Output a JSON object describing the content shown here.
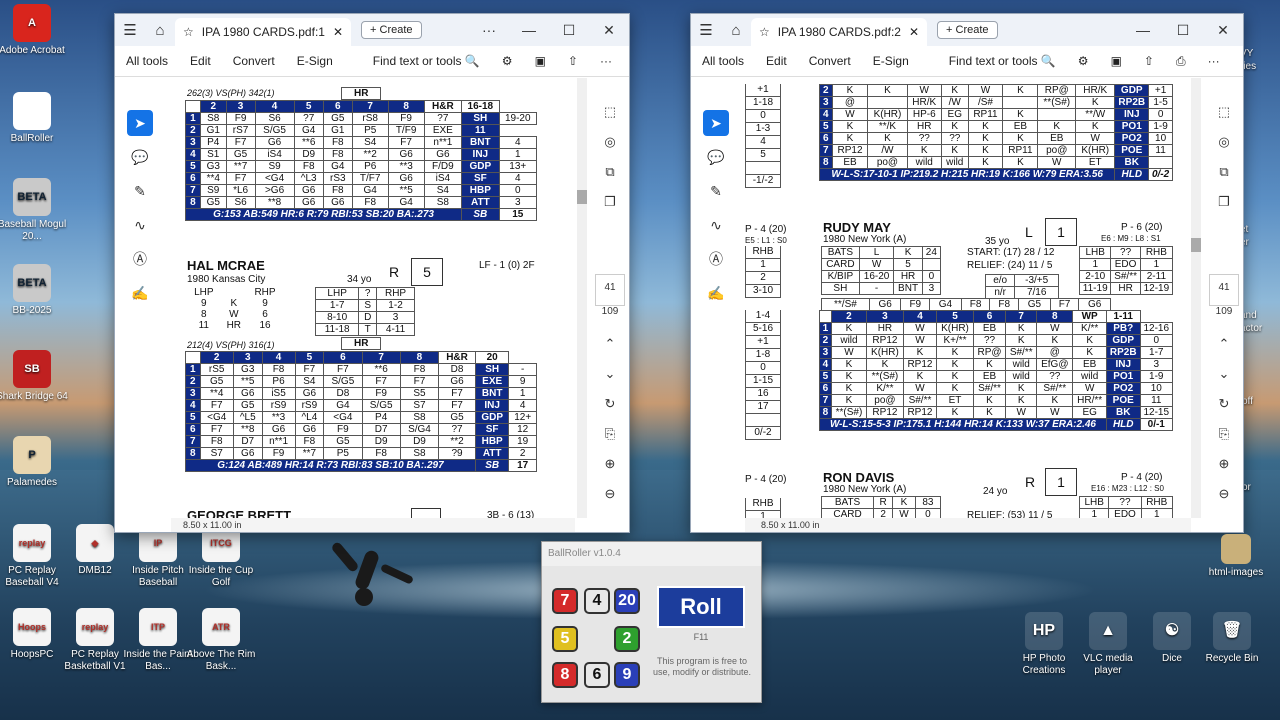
{
  "desktop_left": [
    {
      "label": "Adobe Acrobat",
      "color": "#d9251d",
      "glyph": "A"
    },
    {
      "label": "BallRoller",
      "color": "#ffffff",
      "glyph": ""
    },
    {
      "label": "Baseball Mogul 20...",
      "color": "#c9c9c9",
      "glyph": "BETA"
    },
    {
      "label": "BB-2025",
      "color": "#c9c9c9",
      "glyph": "BETA"
    },
    {
      "label": "Shark Bridge 64",
      "color": "#c02020",
      "glyph": "SB"
    },
    {
      "label": "Palamedes",
      "color": "#e8d6b0",
      "glyph": "P"
    }
  ],
  "desktop_bottom": [
    {
      "label": "PC Replay Baseball V4",
      "glyph": "replay"
    },
    {
      "label": "DMB12",
      "glyph": "◆"
    },
    {
      "label": "Inside Pitch Baseball",
      "glyph": "IP"
    },
    {
      "label": "Inside the Cup Golf",
      "glyph": "ITCG"
    },
    {
      "label": "HoopsPC",
      "glyph": "Hoops"
    },
    {
      "label": "PC Replay Basketball V1",
      "glyph": "replay"
    },
    {
      "label": "Inside the Paint Bas...",
      "glyph": "ITP"
    },
    {
      "label": "Above The Rim Bask...",
      "glyph": "ATR"
    }
  ],
  "desktop_right": [
    {
      "label": "HP Photo Creations",
      "glyph": "HP"
    },
    {
      "label": "VLC media player",
      "glyph": "▲"
    },
    {
      "label": "Dice",
      "glyph": "☯"
    },
    {
      "label": "Recycle Bin",
      "glyph": "🗑"
    }
  ],
  "desktop_right_partial": [
    "html-images"
  ],
  "clipped_edge_labels": [
    "VY",
    "ries",
    "et",
    "er",
    "and",
    "actor",
    "off",
    "or"
  ],
  "win1": {
    "tab_title": "IPA 1980 CARDS.pdf:1",
    "create": "Create",
    "menu": [
      "All tools",
      "Edit",
      "Convert",
      "E-Sign"
    ],
    "find": "Find text or tools",
    "page_num": "41",
    "page_total": "109",
    "size": "8.50 x 11.00 in",
    "card1": {
      "split": "262(3)  VS(PH)  342(1)",
      "hr_lbl": "HR",
      "header": [
        "1",
        "2",
        "3",
        "4",
        "5",
        "6",
        "7",
        "8",
        "H&R",
        "16-18"
      ],
      "rows": [
        [
          "1",
          "S8",
          "F9",
          "S6",
          "?7",
          "G5",
          "rS8",
          "F9",
          "?7",
          "SH",
          "19-20"
        ],
        [
          "2",
          "G1",
          "rS7",
          "S/G5",
          "G4",
          "G1",
          "P5",
          "T/F9",
          "EXE",
          "11"
        ],
        [
          "3",
          "P4",
          "F7",
          "G6",
          "**6",
          "F8",
          "S4",
          "F7",
          "n**1",
          "BNT",
          "4"
        ],
        [
          "4",
          "S1",
          "G5",
          "iS4",
          "D9",
          "F8",
          "**2",
          "G6",
          "G6",
          "INJ",
          "1"
        ],
        [
          "5",
          "G3",
          "**7",
          "S9",
          "F8",
          "G4",
          "P6",
          "**3",
          "F/D9",
          "GDP",
          "13+"
        ],
        [
          "6",
          "**4",
          "F7",
          "<G4",
          "^L3",
          "rS3",
          "T/F7",
          "G6",
          "iS4",
          "SF",
          "4"
        ],
        [
          "7",
          "S9",
          "*L6",
          ">G6",
          "G6",
          "F8",
          "G4",
          "**5",
          "S4",
          "HBP",
          "0"
        ],
        [
          "8",
          "G5",
          "S6",
          "**8",
          "G6",
          "G6",
          "F8",
          "G4",
          "S8",
          "ATT",
          "3"
        ]
      ],
      "stat": "G:153  AB:549  HR:6  R:79  RBI:53  SB:20  BA:.273",
      "stat_code": "SB",
      "stat_val": "15"
    },
    "card2": {
      "name": "HAL MCRAE",
      "team": "1980 Kansas City",
      "age": "34 yo",
      "hand": "R",
      "box": "5",
      "pos": "LF - 1 (0) 2F",
      "lhp_rhp_left": [
        [
          "LHP",
          "",
          "RHP"
        ],
        [
          "9",
          "K",
          "9"
        ],
        [
          "8",
          "W",
          "6"
        ],
        [
          "11",
          "HR",
          "16"
        ]
      ],
      "lhp_rhp_right": [
        [
          "LHP",
          "?",
          "RHP"
        ],
        [
          "1-7",
          "S",
          "1-2"
        ],
        [
          "8-10",
          "D",
          "3"
        ],
        [
          "11-18",
          "T",
          "4-11"
        ]
      ],
      "split": "212(4)  VS(PH)  316(1)",
      "hr_lbl": "HR",
      "header": [
        "1",
        "2",
        "3",
        "4",
        "5",
        "6",
        "7",
        "8",
        "H&R",
        "20"
      ],
      "rows": [
        [
          "1",
          "rS5",
          "G3",
          "F8",
          "F7",
          "F7",
          "**6",
          "F8",
          "D8",
          "SH",
          "-"
        ],
        [
          "2",
          "G5",
          "**5",
          "P6",
          "S4",
          "S/G5",
          "F7",
          "F7",
          "G6",
          "EXE",
          "9"
        ],
        [
          "3",
          "**4",
          "G6",
          "iS5",
          "G6",
          "D8",
          "F9",
          "S5",
          "F7",
          "BNT",
          "1"
        ],
        [
          "4",
          "F7",
          "G5",
          "rS9",
          "rS9",
          "G4",
          "S/G5",
          "S7",
          "F7",
          "INJ",
          "4"
        ],
        [
          "5",
          "<G4",
          "^L5",
          "**3",
          "^L4",
          "<G4",
          "P4",
          "S8",
          "G5",
          "GDP",
          "12+"
        ],
        [
          "6",
          "F7",
          "**8",
          "G6",
          "G6",
          "F9",
          "D7",
          "S/G4",
          "?7",
          "SF",
          "12"
        ],
        [
          "7",
          "F8",
          "D7",
          "n**1",
          "F8",
          "G5",
          "D9",
          "D9",
          "**2",
          "HBP",
          "19"
        ],
        [
          "8",
          "S7",
          "G6",
          "F9",
          "**7",
          "P5",
          "F8",
          "S8",
          "?9",
          "ATT",
          "2"
        ]
      ],
      "stat": "G:124  AB:489  HR:14  R:73  RBI:83  SB:10  BA:.297",
      "stat_code": "SB",
      "stat_val": "17"
    },
    "card3_name": "GEORGE BRETT",
    "card3_pos": "3B - 6 (13)"
  },
  "win2": {
    "tab_title": "IPA 1980 CARDS.pdf:2",
    "create": "Create",
    "menu": [
      "All tools",
      "Edit",
      "Convert",
      "E-Sign"
    ],
    "find": "Find text or tools",
    "page_num": "41",
    "page_total": "109",
    "size": "8.50 x 11.00 in",
    "left_col_top": [
      "+1",
      "1-18",
      "0",
      "1-3",
      "4",
      "5",
      "",
      "-1/-2"
    ],
    "top_rows": [
      [
        "2",
        "K",
        "K",
        "W",
        "K",
        "W",
        "K",
        "RP@",
        "HR/K",
        "GDP",
        "+1"
      ],
      [
        "3",
        "@",
        "",
        "HR/K",
        "/W",
        "/S#",
        "",
        "**(S#)",
        "K",
        "RP2B",
        "1-5"
      ],
      [
        "4",
        "W",
        "K(HR)",
        "HP-6",
        "EG",
        "RP11",
        "K",
        "",
        "**/W",
        "INJ",
        "0"
      ],
      [
        "5",
        "K",
        "**/K",
        "HR",
        "K",
        "K",
        "EB",
        "K",
        "K",
        "PO1",
        "1-9"
      ],
      [
        "6",
        "K",
        "K",
        "??",
        "??",
        "K",
        "K",
        "EB",
        "W",
        "PO2",
        "10"
      ],
      [
        "7",
        "RP12",
        "/W",
        "K",
        "K",
        "K",
        "RP11",
        "po@",
        "K(HR)",
        "POE",
        "11"
      ],
      [
        "8",
        "EB",
        "po@",
        "wild",
        "wild",
        "K",
        "K",
        "W",
        "ET",
        "BK",
        ""
      ]
    ],
    "top_stat": "W-L-S:17-10-1  IP:219.2  H:215  HR:19  K:166  W:79  ERA:3.56",
    "top_stat_code": "HLD",
    "top_stat_val": "0/-2",
    "side_pos1": "P - 4 (20)",
    "side_e1": "E5 : L1 : S0",
    "side_left_mid": [
      "RHB",
      "1",
      "2",
      "3-10"
    ],
    "side_left_rows": [
      "1-4",
      "5-16",
      "+1",
      "1-8",
      "0",
      "1-15",
      "16",
      "17",
      "",
      "0/-2"
    ],
    "rudy": {
      "name": "RUDY MAY",
      "team": "1980 New York (A)",
      "age": "35 yo",
      "hand": "L",
      "box": "1",
      "pos": "P - 6 (20)",
      "e": "E6 : M9 : L8 : S1",
      "start": "START: (17) 28 / 12",
      "relief": "RELIEF: (24) 11 / 5",
      "bats": [
        [
          "BATS",
          "L",
          "K",
          "24"
        ],
        [
          "CARD",
          "W",
          "5",
          ""
        ],
        [
          "K/BIP",
          "16-20",
          "HR",
          "0"
        ],
        [
          "SH",
          "-",
          "BNT",
          "3"
        ]
      ],
      "eo": [
        [
          "e/o",
          "-3/+5"
        ],
        [
          "n/r",
          "7/16"
        ]
      ],
      "lhb": [
        [
          "LHB",
          "??",
          "RHB"
        ],
        [
          "1",
          "EDO",
          "1"
        ],
        [
          "2-10",
          "S#/**",
          "2-11"
        ],
        [
          "11-19",
          "HR",
          "12-19"
        ]
      ],
      "g_row": [
        "**/S#",
        "G6",
        "F9",
        "G4",
        "F8",
        "F8",
        "G5",
        "F7",
        "G6"
      ],
      "header": [
        "1",
        "2",
        "3",
        "4",
        "5",
        "6",
        "7",
        "8",
        "WP",
        "1-11"
      ],
      "rows": [
        [
          "1",
          "K",
          "HR",
          "W",
          "K(HR)",
          "EB",
          "K",
          "W",
          "K/**",
          "PB?",
          "12-16"
        ],
        [
          "2",
          "wild",
          "RP12",
          "W",
          "K+/**",
          "??",
          "K",
          "K",
          "K",
          "GDP",
          "0"
        ],
        [
          "3",
          "W",
          "K(HR)",
          "K",
          "K",
          "RP@",
          "S#/**",
          "@",
          "K",
          "RP2B",
          "1-7"
        ],
        [
          "4",
          "K",
          "K",
          "RP12",
          "K",
          "K",
          "wild",
          "EfG@",
          "EB",
          "INJ",
          "3"
        ],
        [
          "5",
          "K",
          "**(S#)",
          "K",
          "K",
          "EB",
          "wild",
          "??",
          "wild",
          "PO1",
          "1-9"
        ],
        [
          "6",
          "K",
          "K/**",
          "W",
          "K",
          "S#/**",
          "K",
          "S#/**",
          "W",
          "PO2",
          "10"
        ],
        [
          "7",
          "K",
          "po@",
          "S#/**",
          "ET",
          "K",
          "K",
          "K",
          "HR/**",
          "POE",
          "11"
        ],
        [
          "8",
          "**(S#)",
          "RP12",
          "RP12",
          "K",
          "K",
          "W",
          "W",
          "EG",
          "BK",
          "12-15"
        ]
      ],
      "stat": "W-L-S:15-5-3  IP:175.1  H:144  HR:14  K:133  W:37  ERA:2.46",
      "stat_code": "HLD",
      "stat_val": "0/-1"
    },
    "side_pos2": "P - 4 (20)",
    "side_left_bottom": [
      "RHB",
      "1"
    ],
    "ron": {
      "name": "RON DAVIS",
      "team": "1980 New York (A)",
      "age": "24 yo",
      "hand": "R",
      "box": "1",
      "pos": "P - 4 (20)",
      "e": "E16 : M23 : L12 : S0",
      "bats": [
        [
          "BATS",
          "R",
          "K",
          "83"
        ],
        [
          "CARD",
          "2",
          "W",
          "0"
        ]
      ],
      "relief": "RELIEF: (53) 11 / 5",
      "lhb": [
        [
          "LHB",
          "??",
          "RHB"
        ],
        [
          "1",
          "EDO",
          "1"
        ]
      ]
    }
  },
  "ballroller": {
    "title": "BallRoller v1.0.4",
    "dice": [
      {
        "v": "7",
        "c": "#d42a2a"
      },
      {
        "v": "4",
        "c": "#e8e8e8"
      },
      {
        "v": "20",
        "c": "#2a3fb8"
      },
      {
        "v": "5",
        "c": "#e0c020"
      },
      {
        "v": "2",
        "c": "#2ea02e"
      },
      {
        "v": "8",
        "c": "#d42a2a"
      },
      {
        "v": "6",
        "c": "#e8e8e8"
      },
      {
        "v": "9",
        "c": "#2a3fb8"
      }
    ],
    "roll": "Roll",
    "key": "F11",
    "note": "This program is free to use, modify or distribute."
  }
}
